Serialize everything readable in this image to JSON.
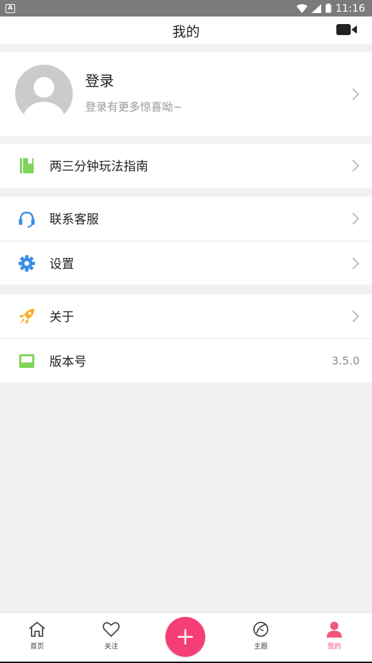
{
  "status_bar": {
    "time": "11:16"
  },
  "header": {
    "title": "我的"
  },
  "profile": {
    "name": "登录",
    "subtitle": "登录有更多惊喜呦~"
  },
  "groups": [
    {
      "items": [
        {
          "label": "两三分钟玩法指南",
          "icon": "book-icon"
        }
      ]
    },
    {
      "items": [
        {
          "label": "联系客服",
          "icon": "headset-icon"
        },
        {
          "label": "设置",
          "icon": "gear-icon"
        }
      ]
    },
    {
      "items": [
        {
          "label": "关于",
          "icon": "rocket-icon"
        },
        {
          "label": "版本号",
          "icon": "inbox-icon",
          "value": "3.5.0"
        }
      ]
    }
  ],
  "bottom_nav": {
    "tabs": [
      {
        "label": "首页",
        "icon": "home-icon"
      },
      {
        "label": "关注",
        "icon": "heart-icon"
      },
      {
        "label": "主题",
        "icon": "leaf-icon"
      },
      {
        "label": "我的",
        "icon": "person-icon",
        "active": true
      }
    ]
  },
  "colors": {
    "accent": "#f53e75",
    "active_tab": "#f0587a",
    "icon_blue": "#3a8ee6",
    "icon_green": "#7fd45a",
    "icon_orange": "#f7b02b"
  }
}
